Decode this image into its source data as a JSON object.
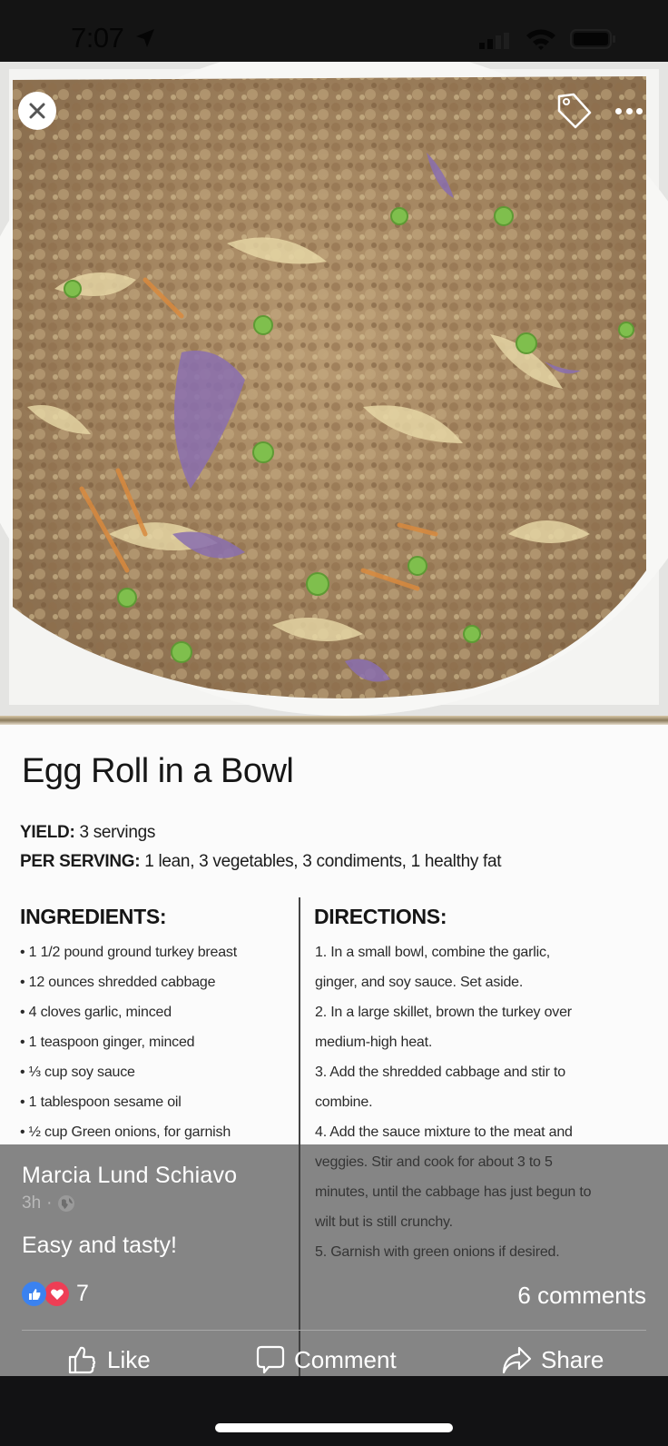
{
  "status_bar": {
    "time": "7:07",
    "icons": [
      "location-arrow-icon",
      "cellular-signal-icon",
      "wifi-icon",
      "battery-icon"
    ]
  },
  "viewer": {
    "close_icon": "close-icon",
    "tag_icon": "tag-icon",
    "more_icon": "more-options-icon"
  },
  "recipe": {
    "title": "Egg Roll in a Bowl",
    "yield_label": "YIELD:",
    "yield_value": "3 servings",
    "per_serving_label": "PER SERVING:",
    "per_serving_value": "1 lean, 3 vegetables, 3 condiments, 1 healthy fat",
    "ingredients_heading": "INGREDIENTS:",
    "ingredients": [
      "1 1/2 pound ground turkey breast",
      "12 ounces shredded cabbage",
      "4 cloves garlic, minced",
      "1 teaspoon ginger, minced",
      "⅓ cup soy sauce",
      "1 tablespoon sesame oil",
      "½ cup Green onions, for garnish"
    ],
    "directions_heading": "DIRECTIONS:",
    "directions_lines": [
      "1. In a small bowl, combine the garlic,",
      "ginger, and soy sauce. Set aside.",
      "2. In a large skillet, brown the turkey over",
      "medium-high heat.",
      "3. Add the shredded cabbage and stir to",
      "combine.",
      "4. Add the sauce mixture to the meat and",
      "veggies. Stir and cook for about 3 to 5",
      "minutes, until the cabbage has just begun to",
      "wilt but is still crunchy.",
      "5. Garnish with green onions if desired."
    ]
  },
  "post": {
    "author": "Marcia Lund Schiavo",
    "time_ago": "3h",
    "separator": "·",
    "privacy_icon": "globe-icon",
    "caption": "Easy and tasty!",
    "reaction_count": "7",
    "reaction_types": [
      "like",
      "love"
    ],
    "comments_label": "6 comments"
  },
  "actions": {
    "like": "Like",
    "comment": "Comment",
    "share": "Share"
  },
  "colors": {
    "like_blue": "#3b82f0",
    "love_red": "#ee3e55",
    "overlay": "#3c3c3c"
  }
}
